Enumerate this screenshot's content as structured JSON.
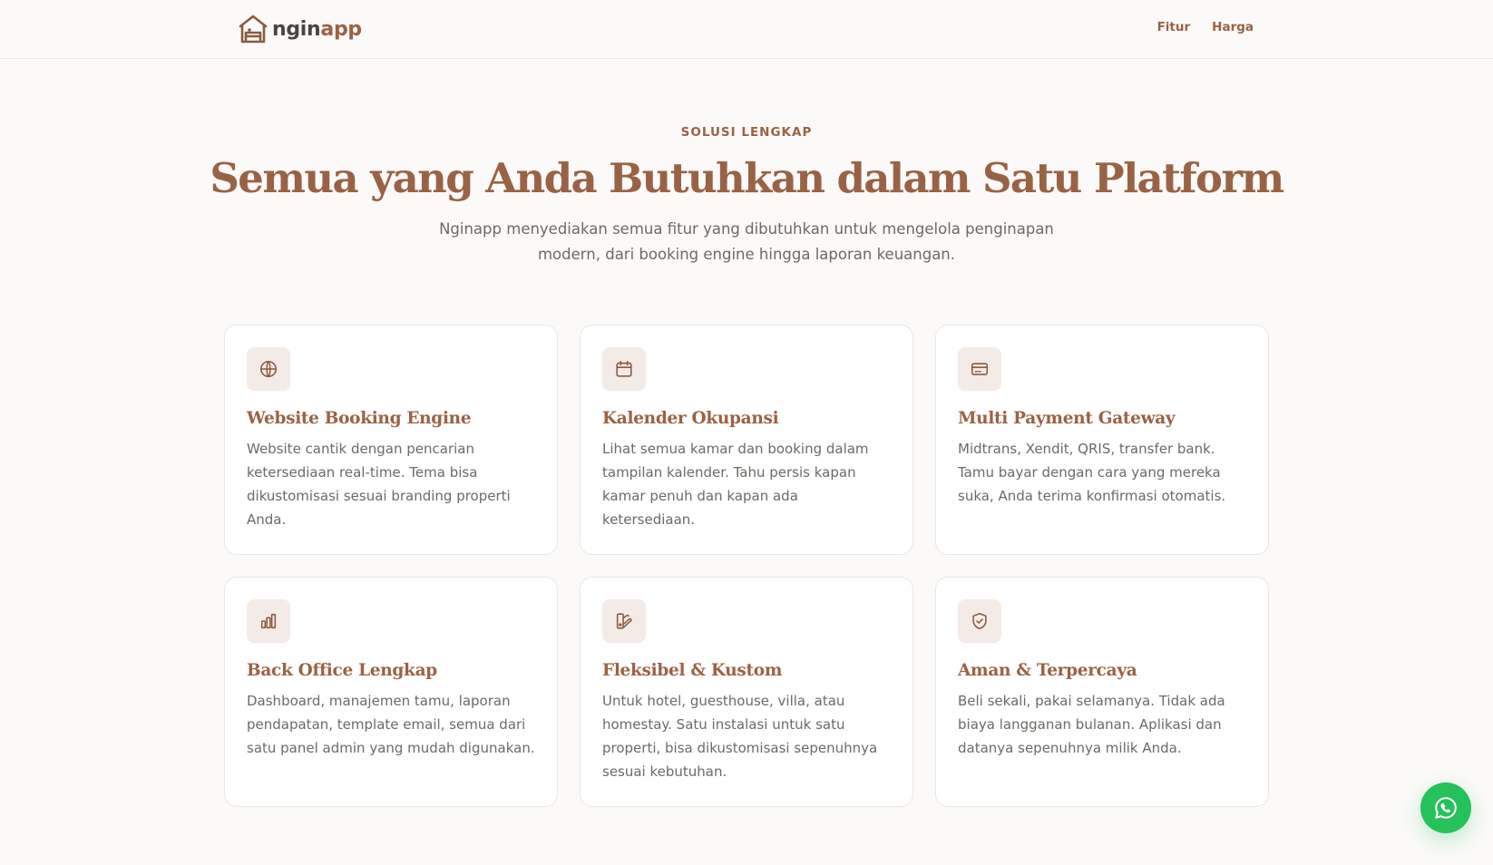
{
  "brand": {
    "name_prefix": "ngin",
    "name_suffix": "app"
  },
  "nav": {
    "items": [
      {
        "label": "Fitur"
      },
      {
        "label": "Harga"
      }
    ]
  },
  "hero": {
    "eyebrow": "SOLUSI LENGKAP",
    "title": "Semua yang Anda Butuhkan dalam Satu Platform",
    "subtitle": "Nginapp menyediakan semua fitur yang dibutuhkan untuk mengelola penginapan modern, dari booking engine hingga laporan keuangan."
  },
  "features": [
    {
      "icon": "globe-icon",
      "title": "Website Booking Engine",
      "description": "Website cantik dengan pencarian ketersediaan real-time. Tema bisa dikustomisasi sesuai branding properti Anda."
    },
    {
      "icon": "calendar-icon",
      "title": "Kalender Okupansi",
      "description": "Lihat semua kamar dan booking dalam tampilan kalender. Tahu persis kapan kamar penuh dan kapan ada ketersediaan."
    },
    {
      "icon": "credit-card-icon",
      "title": "Multi Payment Gateway",
      "description": "Midtrans, Xendit, QRIS, transfer bank. Tamu bayar dengan cara yang mereka suka, Anda terima konfirmasi otomatis."
    },
    {
      "icon": "bar-chart-icon",
      "title": "Back Office Lengkap",
      "description": "Dashboard, manajemen tamu, laporan pendapatan, template email, semua dari satu panel admin yang mudah digunakan."
    },
    {
      "icon": "palette-icon",
      "title": "Fleksibel & Kustom",
      "description": "Untuk hotel, guesthouse, villa, atau homestay. Satu instalasi untuk satu properti, bisa dikustomisasi sepenuhnya sesuai kebutuhan."
    },
    {
      "icon": "shield-check-icon",
      "title": "Aman & Terpercaya",
      "description": "Beli sekali, pakai selamanya. Tidak ada biaya langganan bulanan. Aplikasi dan datanya sepenuhnya milik Anda."
    }
  ],
  "colors": {
    "accent": "#9a6244",
    "icon_bg": "#f5ebe6",
    "whatsapp": "#25c15a"
  },
  "floating": {
    "icon": "whatsapp-icon"
  }
}
